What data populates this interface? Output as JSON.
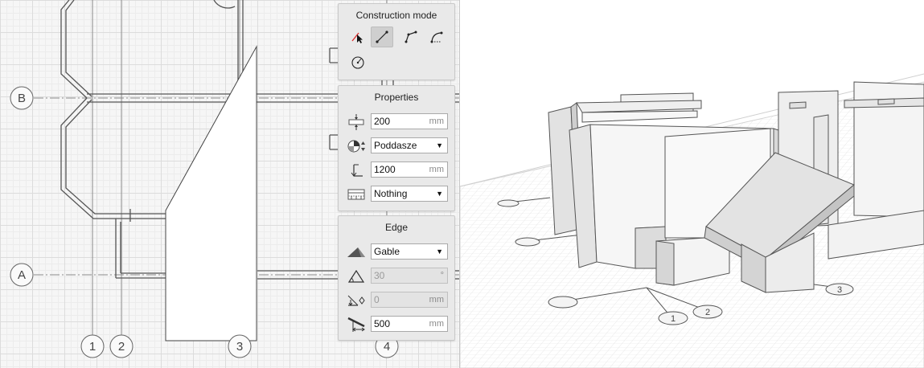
{
  "construction_mode": {
    "title": "Construction mode",
    "tools": [
      {
        "icon": "select-cursor-icon",
        "active": false
      },
      {
        "icon": "straight-line-icon",
        "active": true
      },
      {
        "icon": "polyline-icon",
        "active": false
      },
      {
        "icon": "arc-icon",
        "active": false
      },
      {
        "icon": "circle-icon",
        "active": false
      }
    ]
  },
  "properties": {
    "title": "Properties",
    "thickness": {
      "value": "200",
      "unit": "mm",
      "icon": "thickness-icon"
    },
    "level": {
      "value": "Poddasze",
      "icon": "level-icon"
    },
    "height": {
      "value": "1200",
      "unit": "mm",
      "icon": "height-icon"
    },
    "material": {
      "value": "Nothing",
      "icon": "material-icon"
    }
  },
  "edge": {
    "title": "Edge",
    "type": {
      "value": "Gable",
      "icon": "roof-edge-icon"
    },
    "slope": {
      "value": "30",
      "unit": "°",
      "icon": "slope-icon"
    },
    "offset": {
      "value": "0",
      "unit": "mm",
      "icon": "offset-icon"
    },
    "overhang": {
      "value": "500",
      "unit": "mm",
      "icon": "overhang-icon"
    }
  },
  "plan": {
    "grid_row_labels": [
      "B",
      "A"
    ],
    "grid_col_labels": [
      "1",
      "2",
      "3",
      "4"
    ]
  },
  "view3d": {
    "axis_labels": [
      "1",
      "2",
      "3"
    ]
  }
}
